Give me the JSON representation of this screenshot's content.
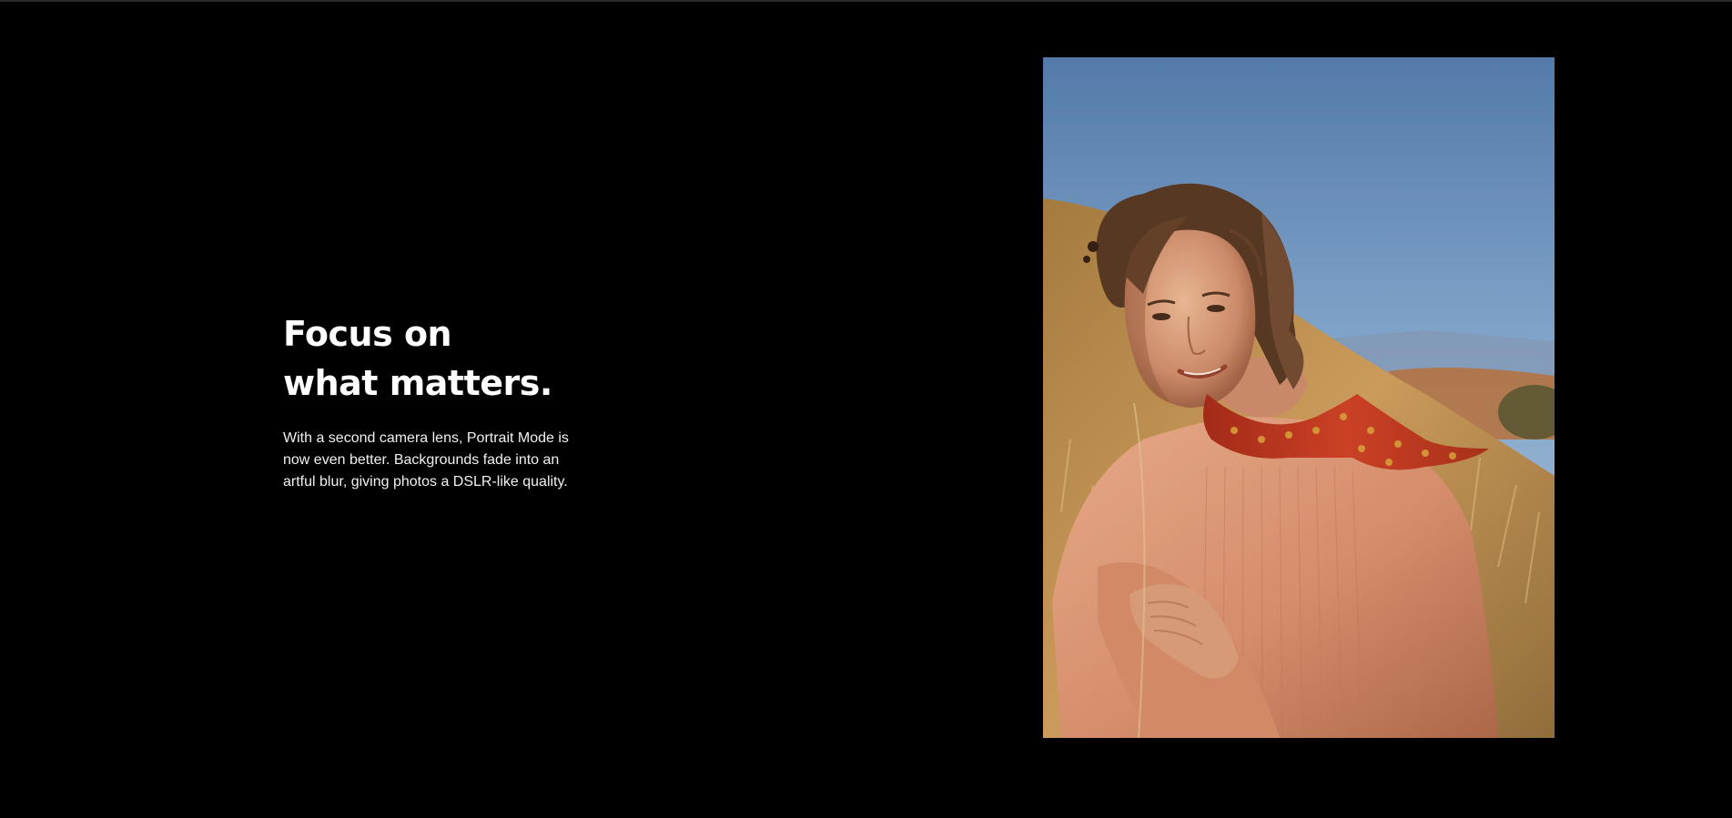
{
  "feature": {
    "headline_line1": "Focus on",
    "headline_line2": "what matters.",
    "description": "With a second camera lens, Portrait Mode is now even better. Backgrounds fade into an artful blur, giving photos a DSLR-like quality."
  },
  "image": {
    "subject": "portrait-photo",
    "colors": {
      "sky_top": "#4f7fb3",
      "sky_bottom": "#8fb4d8",
      "hill": "#b88a4a",
      "sweater": "#d9967a",
      "scarf": "#b8321e",
      "hair": "#5a3a24",
      "skin": "#d7a07e"
    }
  }
}
